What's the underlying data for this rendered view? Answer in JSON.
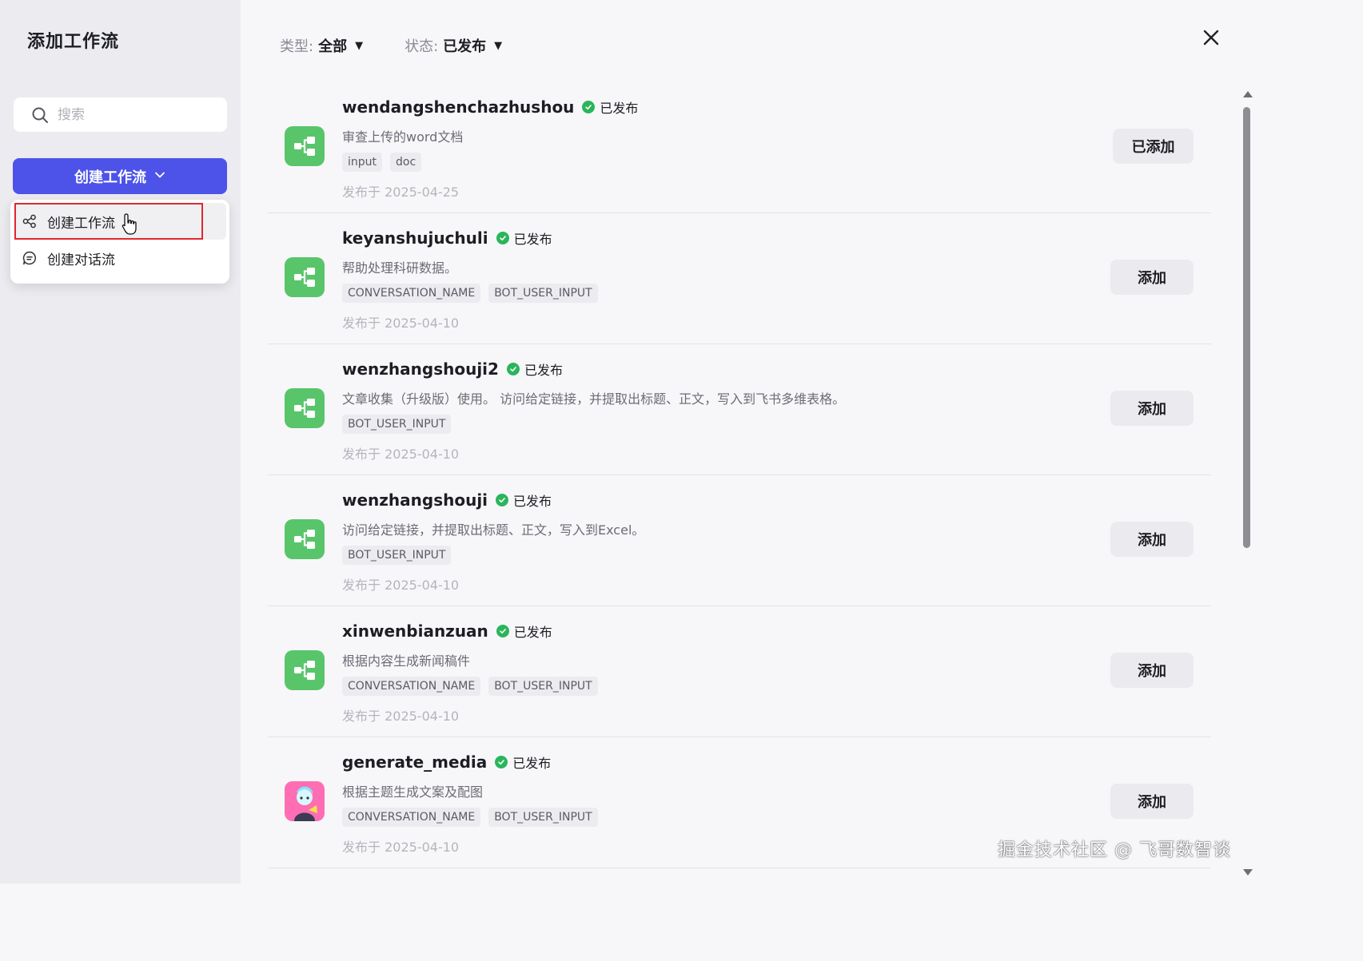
{
  "sidebar": {
    "title": "添加工作流",
    "search_placeholder": "搜索",
    "create_button_label": "创建工作流",
    "dropdown": [
      {
        "label": "创建工作流",
        "icon": "workflow-icon"
      },
      {
        "label": "创建对话流",
        "icon": "chat-icon"
      }
    ]
  },
  "filters": {
    "type_label": "类型:",
    "type_value": "全部",
    "status_label": "状态:",
    "status_value": "已发布"
  },
  "items": [
    {
      "title": "wendangshenchazhushou",
      "status": "已发布",
      "description": "审查上传的word文档",
      "tags": [
        "input",
        "doc"
      ],
      "date": "发布于 2025-04-25",
      "button": "已添加",
      "icon": "workflow-icon"
    },
    {
      "title": "keyanshujuchuli",
      "status": "已发布",
      "description": "帮助处理科研数据。",
      "tags": [
        "CONVERSATION_NAME",
        "BOT_USER_INPUT"
      ],
      "date": "发布于 2025-04-10",
      "button": "添加",
      "icon": "workflow-icon"
    },
    {
      "title": "wenzhangshouji2",
      "status": "已发布",
      "description": "文章收集（升级版）使用。 访问给定链接，并提取出标题、正文，写入到飞书多维表格。",
      "tags": [
        "BOT_USER_INPUT"
      ],
      "date": "发布于 2025-04-10",
      "button": "添加",
      "icon": "workflow-icon"
    },
    {
      "title": "wenzhangshouji",
      "status": "已发布",
      "description": "访问给定链接，并提取出标题、正文，写入到Excel。",
      "tags": [
        "BOT_USER_INPUT"
      ],
      "date": "发布于 2025-04-10",
      "button": "添加",
      "icon": "workflow-icon"
    },
    {
      "title": "xinwenbianzuan",
      "status": "已发布",
      "description": "根据内容生成新闻稿件",
      "tags": [
        "CONVERSATION_NAME",
        "BOT_USER_INPUT"
      ],
      "date": "发布于 2025-04-10",
      "button": "添加",
      "icon": "workflow-icon"
    },
    {
      "title": "generate_media",
      "status": "已发布",
      "description": "根据主题生成文案及配图",
      "tags": [
        "CONVERSATION_NAME",
        "BOT_USER_INPUT"
      ],
      "date": "发布于 2025-04-10",
      "button": "添加",
      "icon": "avatar-image"
    }
  ],
  "watermark": "掘金技术社区 @ 飞哥数智谈",
  "colors": {
    "primary": "#4d53e8",
    "workflow_icon_bg": "#59c56a",
    "status_green": "#2bb55b",
    "highlight_red": "#e0282e"
  }
}
